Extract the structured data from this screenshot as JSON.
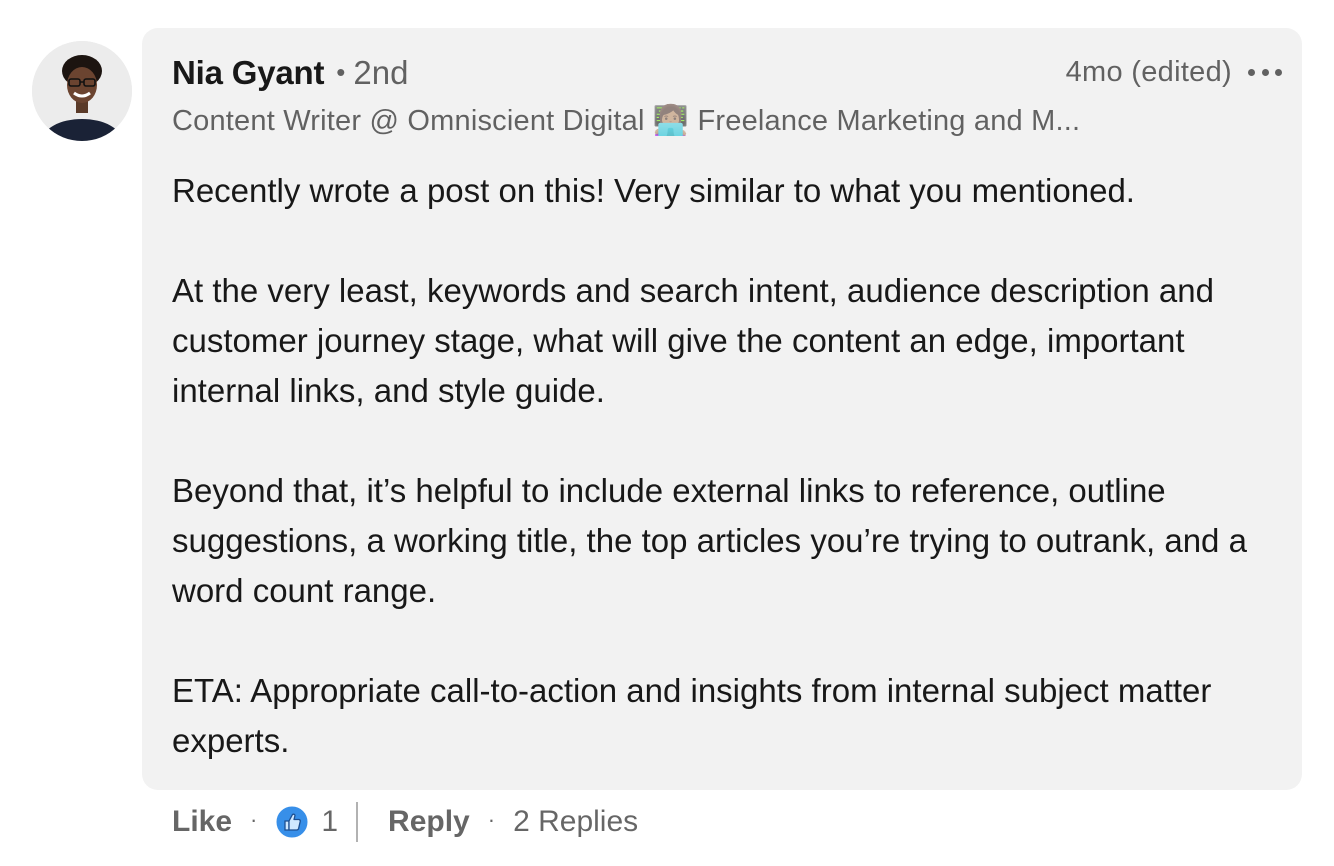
{
  "comment": {
    "author": {
      "name": "Nia Gyant",
      "degree": "2nd",
      "separator": "•",
      "headline": "Content Writer @ Omniscient Digital 👩🏽‍💻 Freelance Marketing and M..."
    },
    "timestamp": "4mo (edited)",
    "more_icon": "ellipsis-icon",
    "paragraphs": [
      "Recently wrote a post on this! Very similar to what you mentioned.",
      "At the very least, keywords and search intent, audience description and customer journey stage, what will give the content an edge, important internal links, and style guide.",
      "Beyond that, it’s helpful to include external links to reference, outline suggestions, a working title, the top articles you’re trying to outrank, and a word count range.",
      "ETA: Appropriate call-to-action and insights from internal subject matter experts."
    ]
  },
  "actions": {
    "like_label": "Like",
    "dot": "·",
    "reaction_icon": "thumbs-up-icon",
    "reaction_count": "1",
    "reply_label": "Reply",
    "replies_label": "2 Replies"
  },
  "colors": {
    "bubble": "#f2f2f2",
    "like_blue": "#378fe9"
  }
}
